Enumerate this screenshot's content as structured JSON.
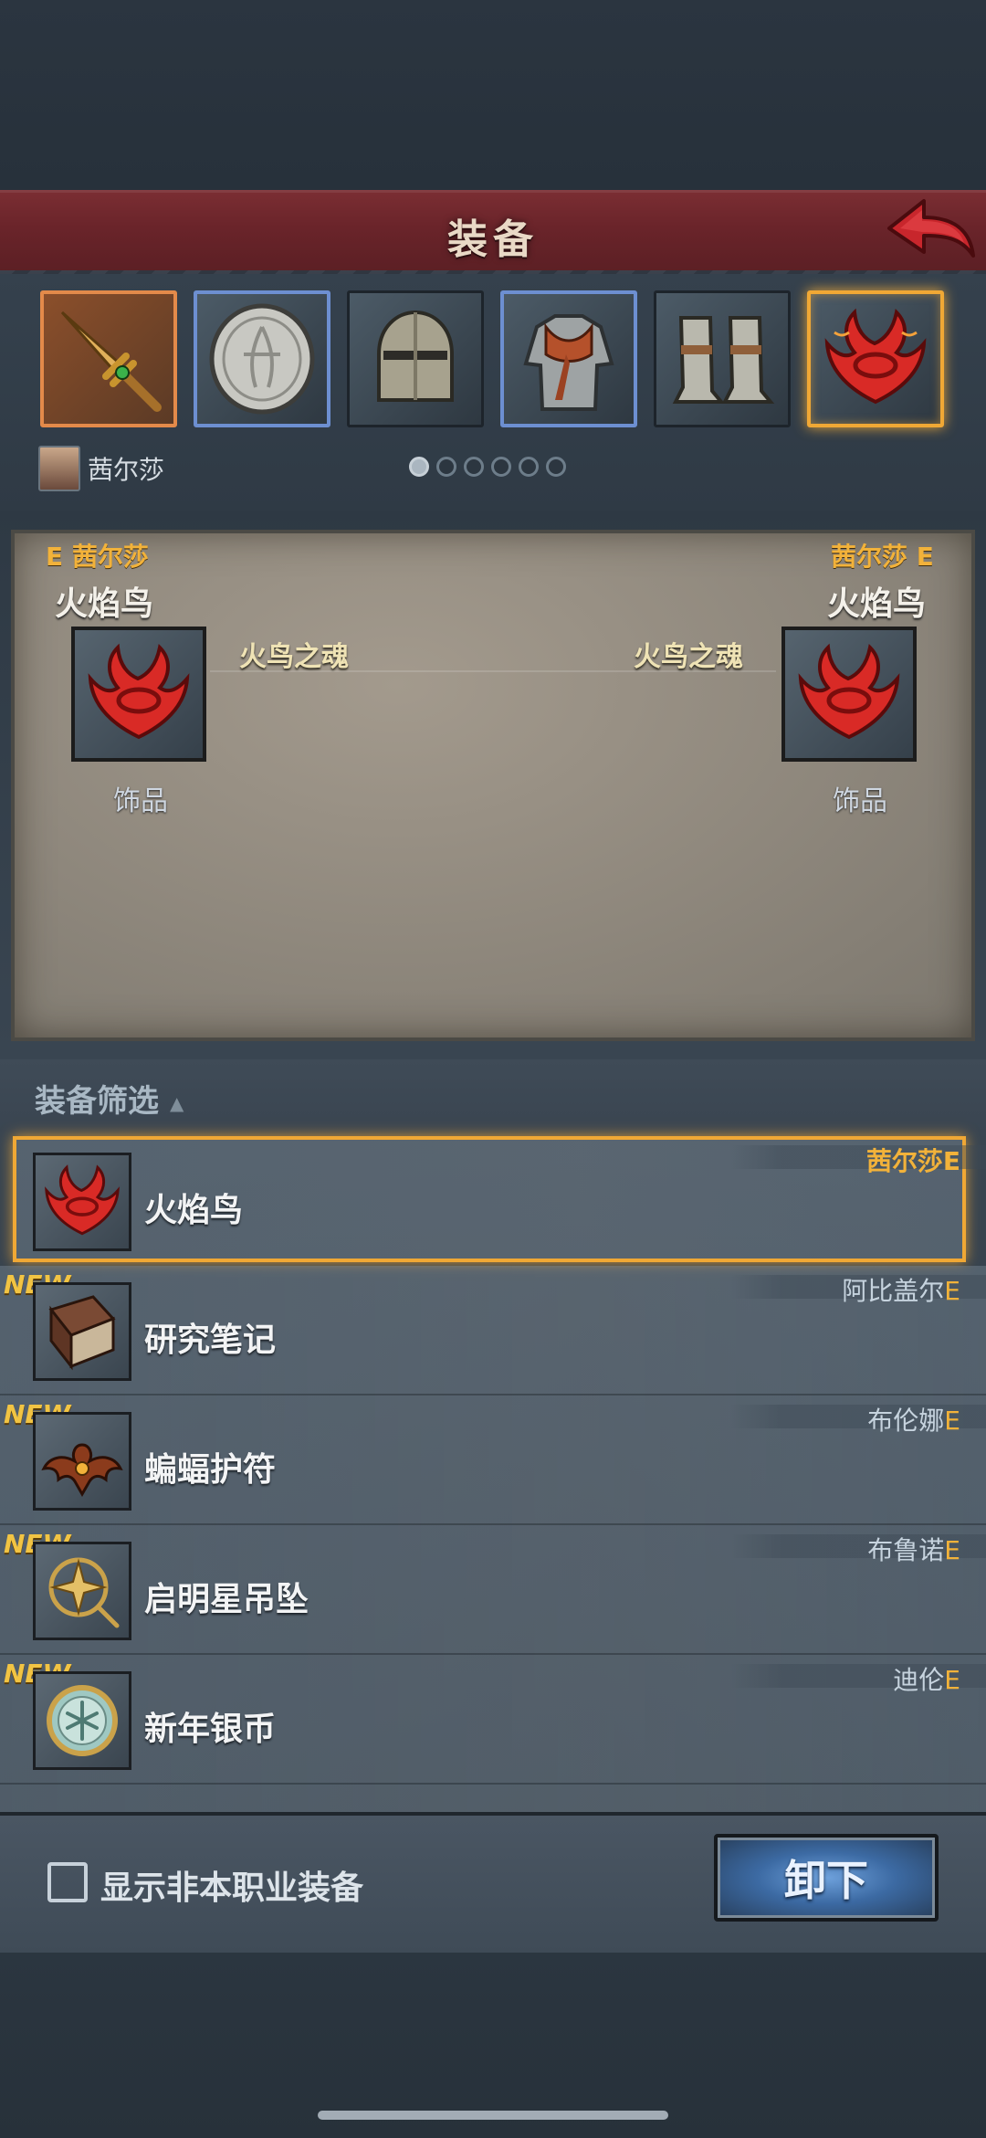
{
  "header": {
    "title": "装备"
  },
  "slots": [
    {
      "name": "sword",
      "icon": "sword-icon",
      "rarity": "orange"
    },
    {
      "name": "shield",
      "icon": "shield-icon",
      "rarity": "blue"
    },
    {
      "name": "helmet",
      "icon": "helmet-icon",
      "rarity": "plain"
    },
    {
      "name": "armor",
      "icon": "armor-icon",
      "rarity": "blue"
    },
    {
      "name": "boots",
      "icon": "boots-icon",
      "rarity": "plain"
    },
    {
      "name": "accessory",
      "icon": "phoenix-icon",
      "rarity": "selected"
    }
  ],
  "character": {
    "name": "茜尔莎"
  },
  "pager": {
    "pages": 6,
    "current": 1
  },
  "compare": {
    "left": {
      "owner": "E 茜尔莎",
      "item": "火焰鸟",
      "set": "火鸟之魂",
      "type": "饰品"
    },
    "right": {
      "owner": "茜尔莎 E",
      "item": "火焰鸟",
      "set": "火鸟之魂",
      "type": "饰品"
    }
  },
  "filter": {
    "label": "装备筛选",
    "arrow": "▲"
  },
  "list": [
    {
      "name": "火焰鸟",
      "owner": "茜尔莎",
      "grade": "E",
      "new": false,
      "selected": true,
      "icon": "phoenix-icon"
    },
    {
      "name": "研究笔记",
      "owner": "阿比盖尔",
      "grade": "E",
      "new": true,
      "new_label": "NEW",
      "icon": "book-icon"
    },
    {
      "name": "蝙蝠护符",
      "owner": "布伦娜",
      "grade": "E",
      "new": true,
      "new_label": "NEW",
      "icon": "bat-icon"
    },
    {
      "name": "启明星吊坠",
      "owner": "布鲁诺",
      "grade": "E",
      "new": true,
      "new_label": "NEW",
      "icon": "compass-star-icon"
    },
    {
      "name": "新年银币",
      "owner": "迪伦",
      "grade": "E",
      "new": true,
      "new_label": "NEW",
      "icon": "coin-icon"
    }
  ],
  "footer": {
    "show_other_class_label": "显示非本职业装备",
    "show_other_class_checked": false,
    "unequip_label": "卸下"
  },
  "colors": {
    "banner": "#6a242a",
    "highlight": "#f0a835",
    "grade": "#f2b23a",
    "button": "#3c6aa3"
  }
}
